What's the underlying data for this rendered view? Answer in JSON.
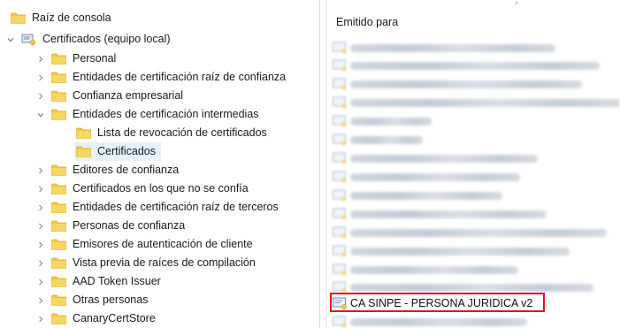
{
  "tree": {
    "root_label": "Raíz de consola",
    "certs_node_label": "Certificados (equipo local)",
    "items": [
      {
        "label": "Personal",
        "expanded": false
      },
      {
        "label": "Entidades de certificación raíz de confianza",
        "expanded": false
      },
      {
        "label": "Confianza empresarial",
        "expanded": false
      },
      {
        "label": "Entidades de certificación intermedias",
        "expanded": true
      },
      {
        "label": "Lista de revocación de certificados",
        "child": true
      },
      {
        "label": "Certificados",
        "child": true,
        "selected": true
      },
      {
        "label": "Editores de confianza",
        "expanded": false
      },
      {
        "label": "Certificados en los que no se confía",
        "expanded": false
      },
      {
        "label": "Entidades de certificación raíz de terceros",
        "expanded": false
      },
      {
        "label": "Personas de confianza",
        "expanded": false
      },
      {
        "label": "Emisores de autenticación de cliente",
        "expanded": false
      },
      {
        "label": "Vista previa de raíces de compilación",
        "expanded": false
      },
      {
        "label": "AAD Token Issuer",
        "expanded": false
      },
      {
        "label": "Otras personas",
        "expanded": false
      },
      {
        "label": "CanaryCertStore",
        "expanded": false
      }
    ]
  },
  "list": {
    "column_header": "Emitido para",
    "highlighted_item": "CA SINPE - PERSONA JURIDICA v2",
    "highlight_color": "#e0161b"
  },
  "colors": {
    "selection": "#e5f1fb",
    "folder": "#f3c845",
    "accent": "#e0161b"
  }
}
